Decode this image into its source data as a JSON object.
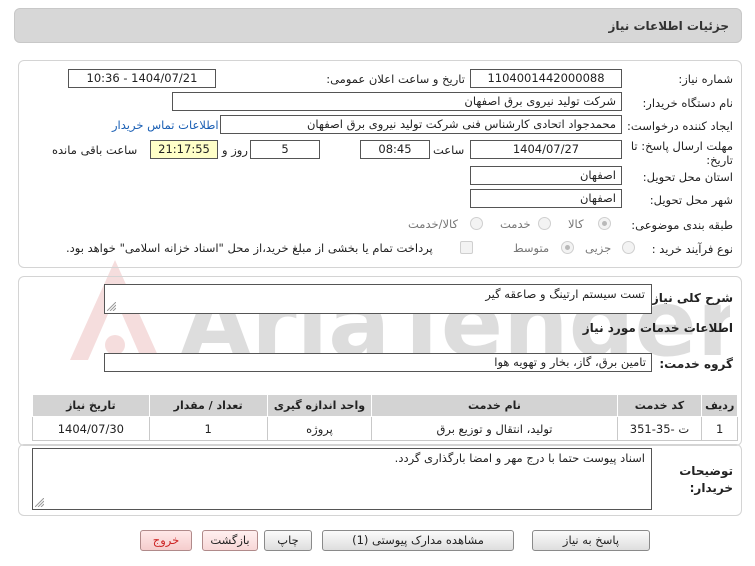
{
  "header": {
    "title": "جزئیات اطلاعات نیاز"
  },
  "watermark_text": "AriaTender.net",
  "form": {
    "need_number_label": "شماره نیاز:",
    "need_number": "1104001442000088",
    "announce_label": "تاریخ و ساعت اعلان عمومی:",
    "announce_value": "1404/07/21 - 10:36",
    "buyer_org_label": "نام دستگاه خریدار:",
    "buyer_org": "شرکت تولید نیروی برق اصفهان",
    "creator_label": "ایجاد کننده درخواست:",
    "creator": "محمدجواد اتحادی کارشناس فنی شرکت تولید نیروی برق اصفهان",
    "contact_link": "اطلاعات تماس خریدار",
    "deadline_label": "مهلت ارسال پاسخ: تا تاریخ:",
    "deadline_date": "1404/07/27",
    "time_label": "ساعت",
    "deadline_time": "08:45",
    "days_value": "5",
    "days_label": "روز و",
    "remaining_time": "21:17:55",
    "remaining_label": "ساعت باقی مانده",
    "province_label": "استان محل تحویل:",
    "province": "اصفهان",
    "city_label": "شهر محل تحویل:",
    "city": "اصفهان",
    "category_label": "طبقه بندی موضوعی:",
    "category_options": [
      "کالا",
      "خدمت",
      "کالا/خدمت"
    ],
    "process_label": "نوع فرآیند خرید :",
    "process_options": [
      "جزیی",
      "متوسط"
    ],
    "payment_note": "پرداخت تمام یا بخشی از مبلغ خرید،از محل \"اسناد خزانه اسلامی\" خواهد بود."
  },
  "summary": {
    "label": "شرح کلی نیاز:",
    "value": "تست سیستم ارتینگ و صاعقه گیر"
  },
  "services": {
    "section_title": "اطلاعات خدمات مورد نیاز",
    "group_label": "گروه خدمت:",
    "group_value": "تامین برق، گاز، بخار و تهویه هوا",
    "columns": [
      "ردیف",
      "کد خدمت",
      "نام خدمت",
      "واحد اندازه گیری",
      "تعداد / مقدار",
      "تاریخ نیاز"
    ],
    "rows": [
      {
        "index": "1",
        "code": "ت -35-351",
        "name": "تولید، انتقال و توزیع برق",
        "unit": "پروژه",
        "qty": "1",
        "date": "1404/07/30"
      }
    ]
  },
  "notes": {
    "label_line1": "توضیحات",
    "label_line2": "خریدار:",
    "value": "اسناد پیوست حتما با درج مهر و امضا بارگذاری گردد."
  },
  "buttons": {
    "reply": "پاسخ به نیاز",
    "attachments": "مشاهده مدارک پیوستی (1)",
    "print": "چاپ",
    "back": "بازگشت",
    "exit": "خروج"
  }
}
